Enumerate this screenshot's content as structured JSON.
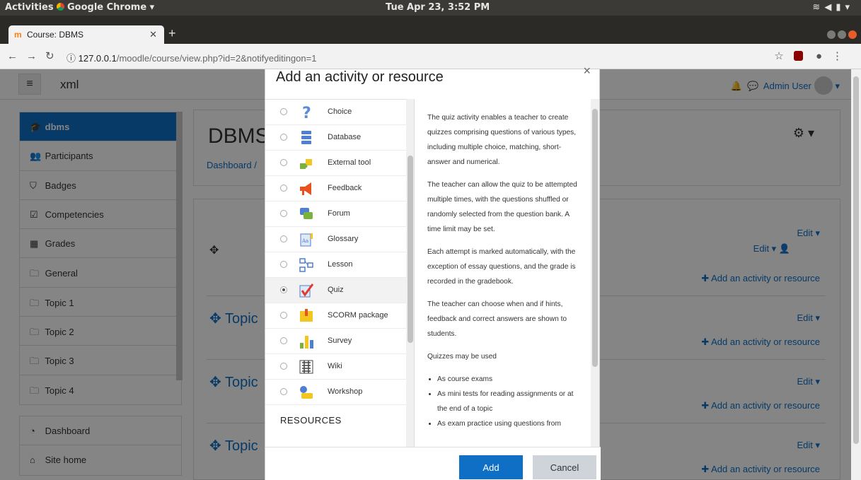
{
  "os": {
    "activities": "Activities",
    "app_name": "Google Chrome ▾",
    "clock": "Tue Apr 23,  3:52 PM"
  },
  "browser": {
    "tab_title": "Course: DBMS",
    "tab_favicon": "m",
    "url_host": "127.0.0.1",
    "url_path": "/moodle/course/view.php?id=2&notifyeditingon=1"
  },
  "navbar": {
    "brand": "xml",
    "user": "Admin User"
  },
  "sidebar": {
    "course_items": [
      {
        "label": "dbms",
        "icon": "graduation-cap-icon",
        "glyph": "🎓",
        "active": true
      },
      {
        "label": "Participants",
        "icon": "users-icon",
        "glyph": "👥"
      },
      {
        "label": "Badges",
        "icon": "shield-icon",
        "glyph": "⛉"
      },
      {
        "label": "Competencies",
        "icon": "check-square-icon",
        "glyph": "☑"
      },
      {
        "label": "Grades",
        "icon": "table-icon",
        "glyph": "▦"
      },
      {
        "label": "General",
        "icon": "folder-icon",
        "glyph": "🗀"
      },
      {
        "label": "Topic 1",
        "icon": "folder-icon",
        "glyph": "🗀"
      },
      {
        "label": "Topic 2",
        "icon": "folder-icon",
        "glyph": "🗀"
      },
      {
        "label": "Topic 3",
        "icon": "folder-icon",
        "glyph": "🗀"
      },
      {
        "label": "Topic 4",
        "icon": "folder-icon",
        "glyph": "🗀"
      }
    ],
    "site_items": [
      {
        "label": "Dashboard",
        "icon": "dashboard-icon",
        "glyph": "◔"
      },
      {
        "label": "Site home",
        "icon": "home-icon",
        "glyph": "⌂"
      }
    ]
  },
  "course": {
    "title": "DBMS",
    "breadcrumb": "Dashboard  /"
  },
  "sections": {
    "edit_label": "Edit",
    "add_label": "Add an activity or resource",
    "topic_label": "Topic"
  },
  "modal": {
    "title": "Add an activity or resource",
    "activities": [
      {
        "label": "Choice",
        "icon": "choice-icon"
      },
      {
        "label": "Database",
        "icon": "database-icon"
      },
      {
        "label": "External tool",
        "icon": "puzzle-icon"
      },
      {
        "label": "Feedback",
        "icon": "megaphone-icon"
      },
      {
        "label": "Forum",
        "icon": "forum-icon"
      },
      {
        "label": "Glossary",
        "icon": "glossary-icon"
      },
      {
        "label": "Lesson",
        "icon": "lesson-icon"
      },
      {
        "label": "Quiz",
        "icon": "quiz-icon",
        "selected": true
      },
      {
        "label": "SCORM package",
        "icon": "scorm-icon"
      },
      {
        "label": "Survey",
        "icon": "survey-icon"
      },
      {
        "label": "Wiki",
        "icon": "wiki-icon"
      },
      {
        "label": "Workshop",
        "icon": "workshop-icon"
      }
    ],
    "resources_heading": "RESOURCES",
    "description": {
      "p1": "The quiz activity enables a teacher to create quizzes comprising questions of various types, including multiple choice, matching, short-answer and numerical.",
      "p2": "The teacher can allow the quiz to be attempted multiple times, with the questions shuffled or randomly selected from the question bank. A time limit may be set.",
      "p3": "Each attempt is marked automatically, with the exception of essay questions, and the grade is recorded in the gradebook.",
      "p4": "The teacher can choose when and if hints, feedback and correct answers are shown to students.",
      "p5": "Quizzes may be used",
      "bullets": [
        "As course exams",
        "As mini tests for reading assignments or at the end of a topic",
        "As exam practice using questions from"
      ]
    },
    "add_button": "Add",
    "cancel_button": "Cancel"
  },
  "colors": {
    "primary": "#0f6fc5",
    "cancel": "#ced4da",
    "os_bar": "#3b3a37"
  }
}
